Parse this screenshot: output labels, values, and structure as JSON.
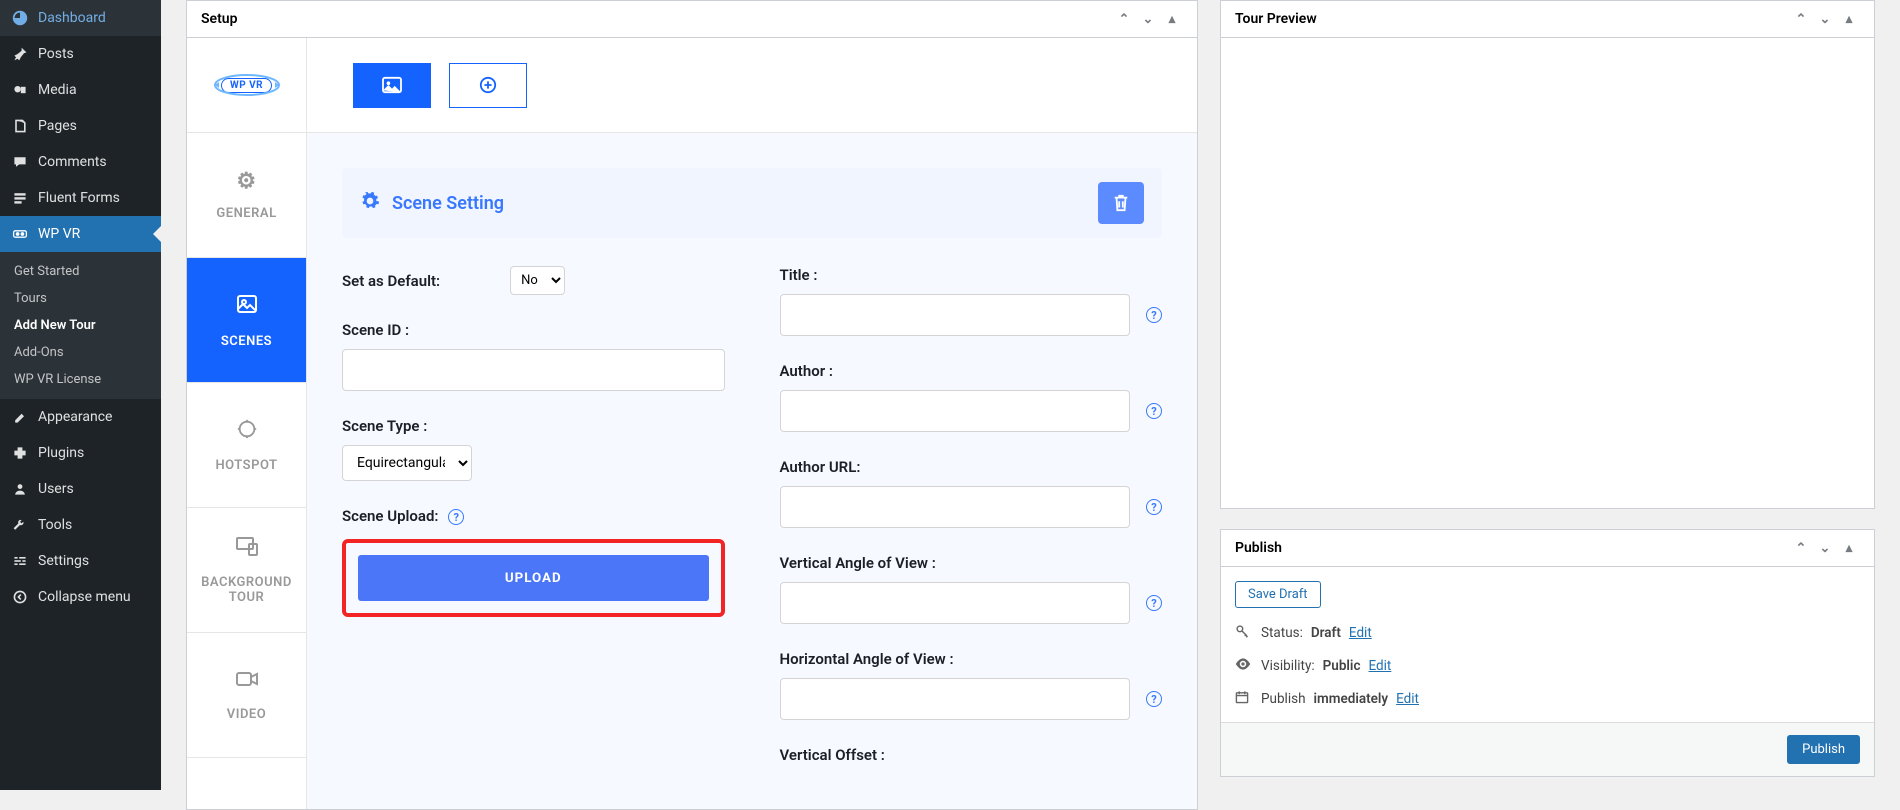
{
  "sidebar": {
    "items": [
      {
        "icon": "⌂",
        "label": "Dashboard"
      },
      {
        "icon": "📌",
        "label": "Posts"
      },
      {
        "icon": "🖼",
        "label": "Media"
      },
      {
        "icon": "▤",
        "label": "Pages"
      },
      {
        "icon": "💬",
        "label": "Comments"
      },
      {
        "icon": "≡",
        "label": "Fluent Forms"
      }
    ],
    "active": {
      "icon": "⊚",
      "label": "WP VR"
    },
    "submenu": [
      "Get Started",
      "Tours",
      "Add New Tour",
      "Add-Ons",
      "WP VR License"
    ],
    "items2": [
      {
        "icon": "🖌",
        "label": "Appearance"
      },
      {
        "icon": "🔌",
        "label": "Plugins"
      },
      {
        "icon": "👤",
        "label": "Users"
      },
      {
        "icon": "🔧",
        "label": "Tools"
      },
      {
        "icon": "▦",
        "label": "Settings"
      },
      {
        "icon": "◀",
        "label": "Collapse menu"
      }
    ]
  },
  "setup": {
    "title": "Setup",
    "logo_text": "WP VR",
    "tabs": {
      "general": "GENERAL",
      "scenes": "SCENES",
      "hotspot": "HOTSPOT",
      "background_tour": "BACKGROUND TOUR",
      "video": "VIDEO"
    },
    "scene_setting": "Scene Setting",
    "labels": {
      "set_default": "Set as Default:",
      "scene_id": "Scene ID :",
      "scene_type": "Scene Type :",
      "scene_upload": "Scene Upload:",
      "title": "Title :",
      "author": "Author :",
      "author_url": "Author URL:",
      "v_angle": "Vertical Angle of View :",
      "h_angle": "Horizontal Angle of View :",
      "v_offset": "Vertical Offset :"
    },
    "default_value": "No",
    "scene_type_value": "Equirectangular",
    "upload_button": "UPLOAD"
  },
  "tour_preview": {
    "title": "Tour Preview"
  },
  "publish": {
    "title": "Publish",
    "save_draft": "Save Draft",
    "status_label": "Status:",
    "status_value": "Draft",
    "visibility_label": "Visibility:",
    "visibility_value": "Public",
    "schedule_label": "Publish",
    "schedule_value": "immediately",
    "edit": "Edit",
    "publish_btn": "Publish"
  }
}
